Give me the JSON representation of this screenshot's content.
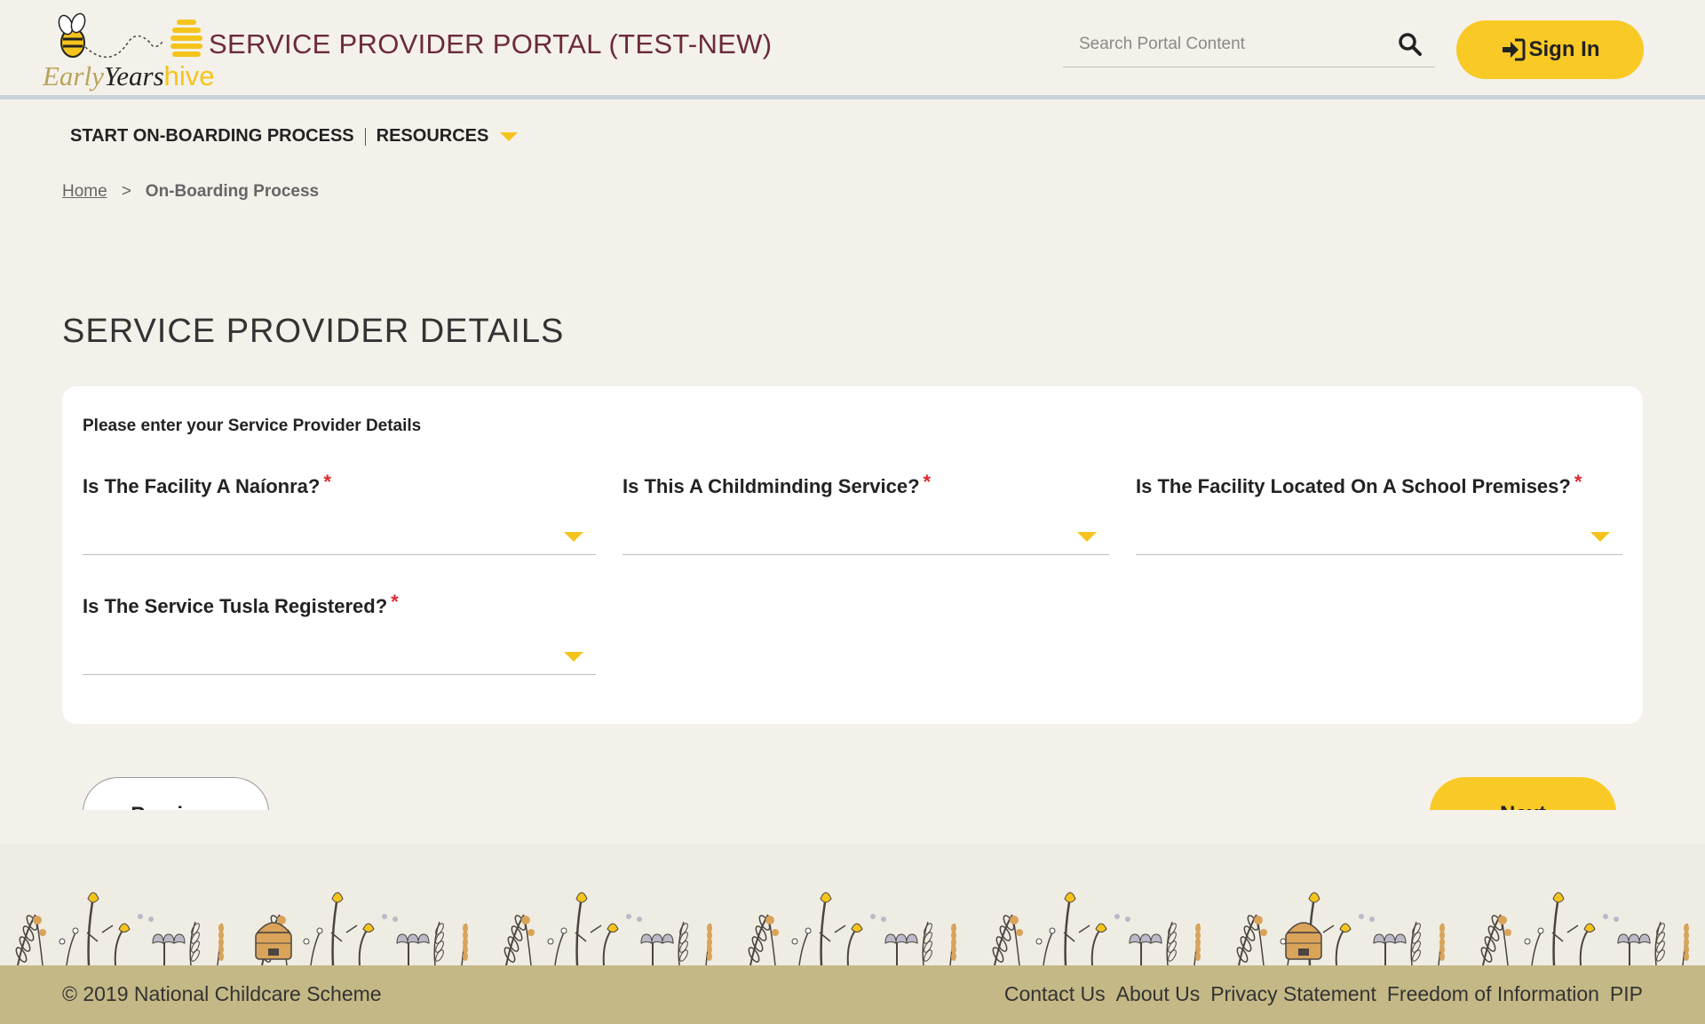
{
  "header": {
    "logo": {
      "word_early": "Early",
      "word_years": "Years",
      "word_hive": "hive"
    },
    "portal_title": "SERVICE PROVIDER PORTAL (TEST-NEW)",
    "search": {
      "placeholder": "Search Portal Content",
      "icon": "search-icon"
    },
    "sign_in_label": "Sign In",
    "sign_in_icon": "sign-in-icon"
  },
  "nav": {
    "items": [
      {
        "label": "START ON-BOARDING PROCESS"
      },
      {
        "label": "RESOURCES",
        "icon": "caret-down-icon"
      }
    ]
  },
  "breadcrumb": {
    "home": "Home",
    "separator": ">",
    "current": "On-Boarding Process"
  },
  "page": {
    "heading": "SERVICE PROVIDER DETAILS",
    "intro": "Please enter your Service Provider Details"
  },
  "form": {
    "required_mark": "*",
    "fields": [
      {
        "label": "Is The Facility A Naíonra?",
        "value": ""
      },
      {
        "label": "Is This A Childminding Service?",
        "value": ""
      },
      {
        "label": "Is The Facility Located On A School Premises?",
        "value": ""
      },
      {
        "label": "Is The Service Tusla Registered?",
        "value": ""
      }
    ]
  },
  "actions": {
    "previous": "Previous",
    "next": "Next"
  },
  "footer": {
    "copyright": "© 2019 National Childcare Scheme",
    "links": [
      "Contact Us",
      "About Us",
      "Privacy Statement",
      "Freedom of Information",
      "PIP"
    ]
  },
  "colors": {
    "accent_yellow": "#f9c926",
    "title_maroon": "#6b2b34",
    "page_bg": "#f3f1ea",
    "footer_bar": "#c4b886",
    "required_red": "#e0282e"
  }
}
